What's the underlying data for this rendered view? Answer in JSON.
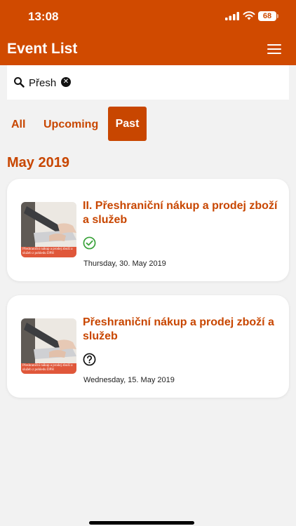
{
  "status_bar": {
    "time": "13:08",
    "battery": "68"
  },
  "header": {
    "title": "Event List"
  },
  "search": {
    "value": "Přesh",
    "placeholder": ""
  },
  "tabs": [
    {
      "label": "All"
    },
    {
      "label": "Upcoming"
    },
    {
      "label": "Past",
      "selected": true
    }
  ],
  "month": "May 2019",
  "events": [
    {
      "title": "II. Přeshraniční nákup a prodej zboží a služeb",
      "date": "Thursday, 30. May 2019",
      "status_icon": "check-circle-icon",
      "thumb_caption": "Přeshraniční nákup a prodej zboží a služeb z pohledu DPH"
    },
    {
      "title": "Přeshraniční nákup a prodej zboží a služeb",
      "date": "Wednesday, 15. May 2019",
      "status_icon": "question-circle-icon",
      "thumb_caption": "Přeshraniční nákup a prodej zboží a služeb z pohledu DPH"
    }
  ],
  "colors": {
    "brand": "#d04a00",
    "accent": "#c84600",
    "check": "#3aa23a"
  }
}
